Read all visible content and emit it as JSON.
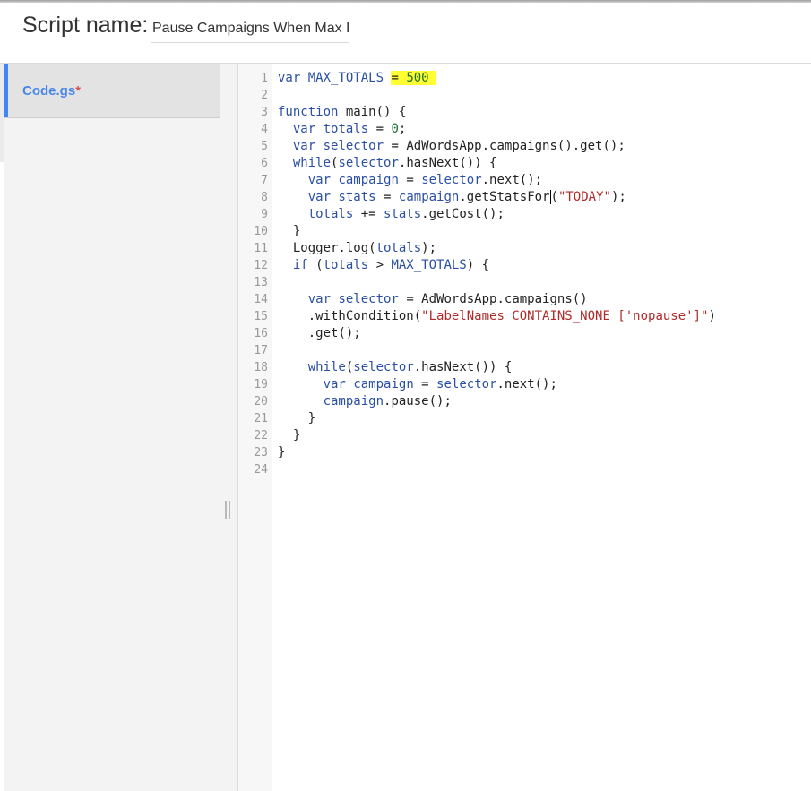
{
  "header": {
    "script_name_label": "Script name:",
    "script_name_value": "Pause Campaigns When Max Daily Spend Reached"
  },
  "sidebar": {
    "files": [
      {
        "name": "Code.gs",
        "modified_marker": "*"
      }
    ]
  },
  "editor": {
    "line_numbers": [
      "1",
      "2",
      "3",
      "4",
      "5",
      "6",
      "7",
      "8",
      "9",
      "10",
      "11",
      "12",
      "13",
      "14",
      "15",
      "16",
      "17",
      "18",
      "19",
      "20",
      "21",
      "22",
      "23",
      "24"
    ],
    "code_lines": [
      "var MAX_TOTALS = 500",
      "",
      "function main() {",
      "  var totals = 0;",
      "  var selector = AdWordsApp.campaigns().get();",
      "  while(selector.hasNext()) {",
      "    var campaign = selector.next();",
      "    var stats = campaign.getStatsFor(\"TODAY\");",
      "    totals += stats.getCost();",
      "  }",
      "  Logger.log(totals);",
      "  if (totals > MAX_TOTALS) {",
      "",
      "    var selector = AdWordsApp.campaigns()",
      "    .withCondition(\"LabelNames CONTAINS_NONE ['nopause']\")",
      "    .get();",
      "",
      "    while(selector.hasNext()) {",
      "      var campaign = selector.next();",
      "      campaign.pause();",
      "    }",
      "  }",
      "}",
      ""
    ]
  }
}
